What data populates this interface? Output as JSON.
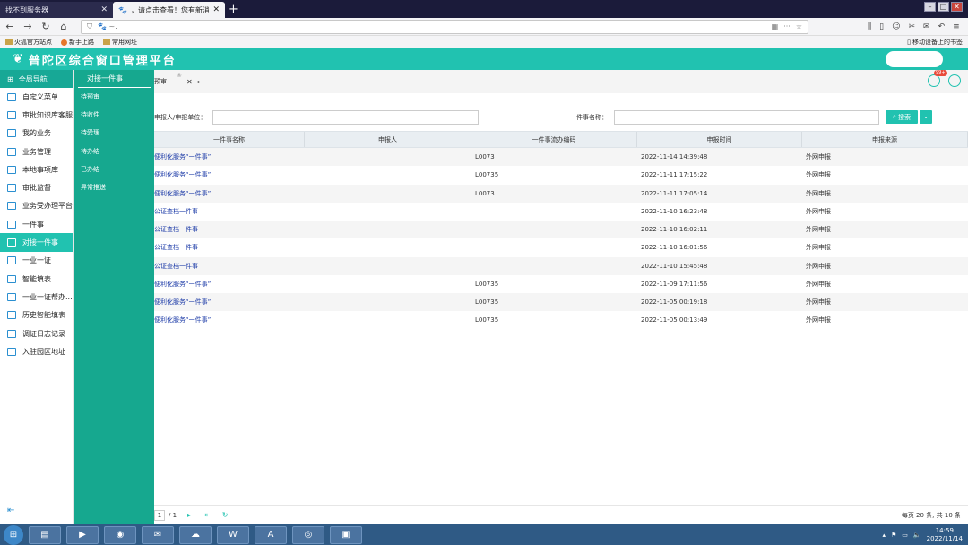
{
  "browser": {
    "tabs": [
      {
        "title": "找不到服务器",
        "active": false
      },
      {
        "title": "，请点击查看！您有新消息提醒",
        "active": true
      }
    ],
    "url_fragment": "🐾 ~.",
    "bookmarks": [
      "火狐官方站点",
      "新手上路",
      "常用网址"
    ],
    "mobile_bookmarks": "移动设备上的书签"
  },
  "app": {
    "title": "普陀区综合窗口管理平台"
  },
  "sidebar": {
    "header": "全局导航",
    "items": [
      {
        "label": "自定义菜单"
      },
      {
        "label": "审批知识库客服"
      },
      {
        "label": "我的业务"
      },
      {
        "label": "业务管理"
      },
      {
        "label": "本地事项库"
      },
      {
        "label": "审批监督"
      },
      {
        "label": "业务受办理平台"
      },
      {
        "label": "一件事"
      },
      {
        "label": "对接一件事",
        "active": true
      },
      {
        "label": "一业一证"
      },
      {
        "label": "智能填表"
      },
      {
        "label": "一业一证帮办..."
      },
      {
        "label": "历史智能填表"
      },
      {
        "label": "调证日志记录"
      },
      {
        "label": "入驻园区地址"
      }
    ]
  },
  "submenu": {
    "header": "对接一件事",
    "items": [
      "待预审",
      "待收件",
      "待受理",
      "待办结",
      "已办结",
      "异常推送"
    ]
  },
  "content": {
    "tab_label": "预审",
    "badge": "99+",
    "search": {
      "label1": "申报人/申报单位：",
      "label2": "一件事名称：",
      "button": "搜索"
    },
    "table": {
      "headers": [
        "一件事名称",
        "申报人",
        "一件事流办编码",
        "申报时间",
        "申报来源"
      ],
      "rows": [
        [
          "便利化服务“一件事”",
          "",
          "L0073",
          "2022-11-14 14:39:48",
          "外网申报"
        ],
        [
          "便利化服务“一件事”",
          "",
          "L00735",
          "2022-11-11 17:15:22",
          "外网申报"
        ],
        [
          "便利化服务“一件事”",
          "",
          "L0073",
          "2022-11-11 17:05:14",
          "外网申报"
        ],
        [
          "公证查档一件事",
          "",
          "",
          "2022-11-10 16:23:48",
          "外网申报"
        ],
        [
          "公证查档一件事",
          "",
          "",
          "2022-11-10 16:02:11",
          "外网申报"
        ],
        [
          "公证查档一件事",
          "",
          "",
          "2022-11-10 16:01:56",
          "外网申报"
        ],
        [
          "公证查档一件事",
          "",
          "",
          "2022-11-10 15:45:48",
          "外网申报"
        ],
        [
          "便利化服务“一件事”",
          "",
          "L00735",
          "2022-11-09 17:11:56",
          "外网申报"
        ],
        [
          "便利化服务“一件事”",
          "",
          "L00735",
          "2022-11-05 00:19:18",
          "外网申报"
        ],
        [
          "便利化服务“一件事”",
          "",
          "L00735",
          "2022-11-05 00:13:49",
          "外网申报"
        ]
      ]
    },
    "pager": {
      "page": "1",
      "total": "/ 1",
      "summary": "每页 20 条, 共 10 条"
    }
  },
  "taskbar": {
    "time": "14:59",
    "date": "2022/11/14"
  },
  "colors": {
    "accent": "#21c2b0",
    "submenu": "#16a88f",
    "link": "#1e3ca8"
  }
}
